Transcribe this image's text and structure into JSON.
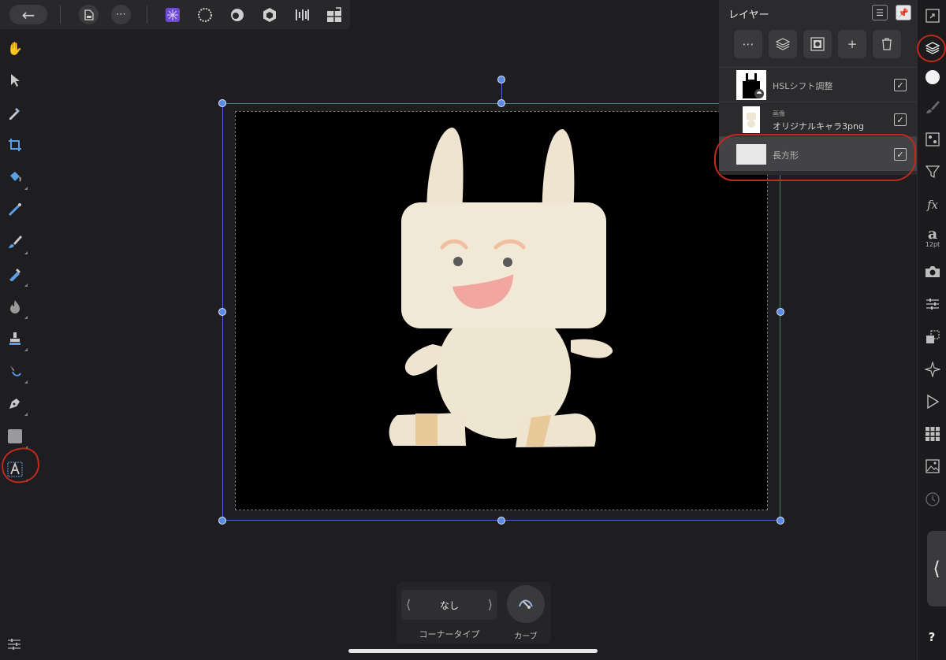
{
  "toolbar": {
    "back_icon": "arrow-left-icon",
    "doc_icon": "document-icon",
    "more_icon": "ellipsis-icon",
    "personas": [
      "photo-persona-icon",
      "liquify-persona-icon",
      "develop-persona-icon",
      "tone-map-persona-icon",
      "export-persona-icon",
      "tile-persona-icon"
    ]
  },
  "left_tools": [
    "hand-tool-icon",
    "move-tool-icon",
    "color-picker-icon",
    "crop-tool-icon",
    "flood-fill-icon",
    "gradient-tool-icon",
    "paint-brush-icon",
    "smudge-brush-icon",
    "burn-brush-icon",
    "clone-brush-icon",
    "selection-brush-icon",
    "pen-tool-icon",
    "rectangle-tool-icon",
    "artistic-text-icon"
  ],
  "layers_panel": {
    "title": "レイヤー",
    "layers": [
      {
        "name": "HSLシフト調整",
        "subtitle": "",
        "visible": true,
        "selected": false
      },
      {
        "name": "オリジナルキャラ3png",
        "subtitle": "画像",
        "visible": true,
        "selected": false
      },
      {
        "name": "長方形",
        "subtitle": "",
        "visible": true,
        "selected": true
      }
    ]
  },
  "context_toolbar": {
    "corner_type_value": "なし",
    "corner_type_label": "コーナータイプ",
    "curve_label": "カーブ"
  },
  "studio": {
    "font_size_label": "12pt",
    "help_label": "?"
  },
  "colors": {
    "accent_blue": "#4a6bd6",
    "annotation_red": "#c0291d",
    "canvas_black": "#000000"
  }
}
